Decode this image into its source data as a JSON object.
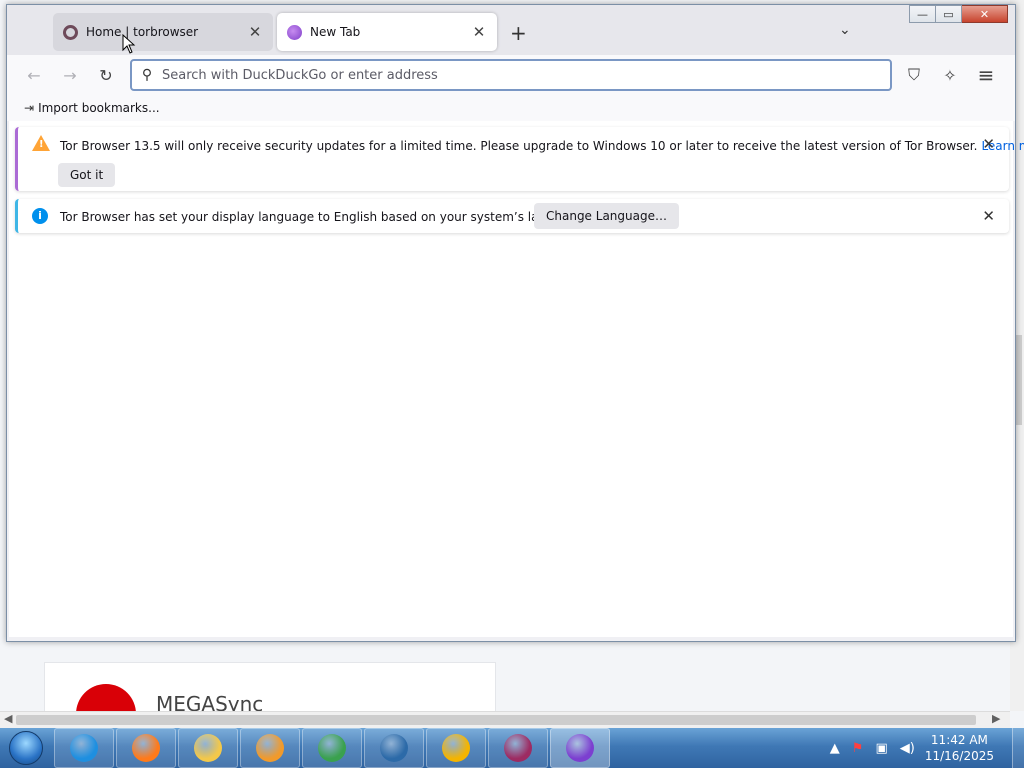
{
  "tabs": [
    {
      "title": "Home | torbrowser",
      "close": "✕"
    },
    {
      "title": "New Tab",
      "close": "✕"
    }
  ],
  "tabbar": {
    "new_tab": "+",
    "list_tabs": "⌄"
  },
  "window_controls": {
    "minimize": "—",
    "maximize": "▭",
    "close": "✕"
  },
  "navbar": {
    "back": "←",
    "forward": "→",
    "reload": "↻",
    "search_placeholder": "Search with DuckDuckGo or enter address",
    "shield": "⛉",
    "new_identity": "✧",
    "menu": "≡"
  },
  "bookmarks": {
    "import_label": "Import bookmarks..."
  },
  "notifications": [
    {
      "message": "Tor Browser 13.5 will only receive security updates for a limited time. Please upgrade to Windows 10 or later to receive the latest version of Tor Browser.",
      "link": "Learn more",
      "button": "Got it",
      "close": "✕"
    },
    {
      "message": "Tor Browser has set your display language to English based on your system’s language.",
      "button": "Change Language…",
      "close": "✕"
    }
  ],
  "background_app": {
    "brand": "MEGASync"
  },
  "taskbar": {
    "apps": [
      {
        "name": "internet-explorer",
        "color": "#1e8fe0"
      },
      {
        "name": "firefox",
        "color": "#ff7a1a"
      },
      {
        "name": "file-explorer",
        "color": "#f3c84a"
      },
      {
        "name": "media-player",
        "color": "#f19a2b"
      },
      {
        "name": "network-tool",
        "color": "#3aa14e"
      },
      {
        "name": "virtualbox",
        "color": "#2c6aa8"
      },
      {
        "name": "keepass-tool",
        "color": "#f4b400"
      },
      {
        "name": "winrar",
        "color": "#9d2b62"
      },
      {
        "name": "tor-browser",
        "color": "#7c3fd0"
      }
    ],
    "clock_time": "11:42 AM",
    "clock_date": "11/16/2025"
  }
}
